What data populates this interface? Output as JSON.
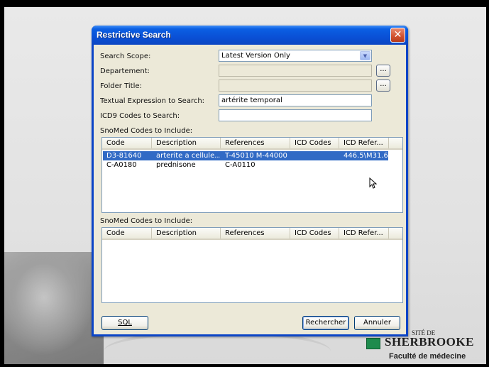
{
  "dialog": {
    "title": "Restrictive Search",
    "close_glyph": "✕"
  },
  "form": {
    "search_scope_label": "Search Scope:",
    "search_scope_value": "Latest Version Only",
    "departement_label": "Departement:",
    "departement_value": "",
    "folder_title_label": "Folder Title:",
    "folder_title_value": "",
    "textual_label": "Textual Expression to Search:",
    "textual_value": "artérite temporal",
    "icd9_label": "ICD9 Codes to Search:",
    "icd9_value": "",
    "browse_label": "..."
  },
  "table1": {
    "caption": "SnoMed Codes to Include:",
    "columns": [
      "Code",
      "Description",
      "References",
      "ICD Codes",
      "ICD Refer..."
    ],
    "rows": [
      {
        "code": "D3-81640",
        "description": "arterite a cellule...",
        "references": "T-45010 M-44000",
        "icd_codes": "",
        "icd_refer": "446.5\\M31.6",
        "selected": true
      },
      {
        "code": "C-A0180",
        "description": "prednisone",
        "references": "C-A0110",
        "icd_codes": "",
        "icd_refer": "",
        "selected": false
      }
    ]
  },
  "table2": {
    "caption": "SnoMed Codes to Include:",
    "columns": [
      "Code",
      "Description",
      "References",
      "ICD Codes",
      "ICD Refer..."
    ],
    "rows": []
  },
  "buttons": {
    "sql": "SQL",
    "rechercher": "Rechercher",
    "annuler": "Annuler"
  },
  "background": {
    "uni_top": "SITÉ DE",
    "uni_name": "SHERBROOKE",
    "faculty": "Faculté de médecine"
  },
  "colors": {
    "title_bar": "#0a50d6",
    "selection": "#316ac5",
    "dialog_bg": "#ece9d8"
  }
}
